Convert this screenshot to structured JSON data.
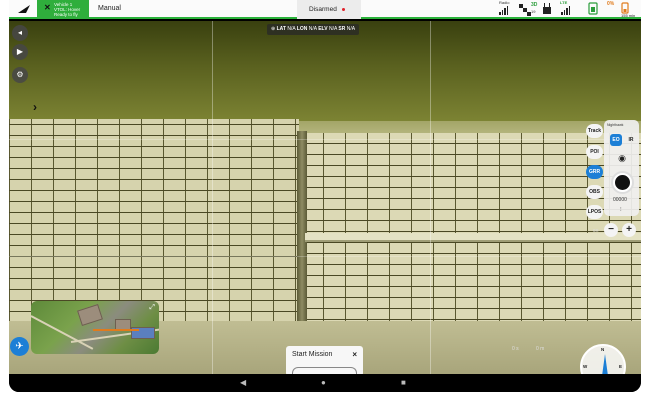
{
  "topbar": {
    "vehicle_line1": "Vehicle 1",
    "vehicle_line2": "VTOL: Hover",
    "vehicle_line3": "Ready to fly",
    "flight_mode": "Manual",
    "arm_status": "Disarmed",
    "status": {
      "radio_label": "Radio",
      "gps_label": "3D",
      "gps_count": "19",
      "lte_label": "LTE",
      "battery_pct": "0%",
      "clock": "155 min"
    },
    "colors": {
      "ready": "#2fae3c",
      "accent": "#1c7fd6",
      "disarmed_dot": "#e0202a"
    }
  },
  "left_tools": [
    "back-icon",
    "play-icon",
    "settings-icon"
  ],
  "gps_readout": {
    "lat_label": "LAT",
    "lat": "N/A",
    "lon_label": "LON",
    "lon": "N/A",
    "elv_label": "ELV",
    "elv": "N/A",
    "sr_label": "SR",
    "sr": "N/A"
  },
  "right_panel": {
    "track": "Track",
    "poi": "POI",
    "grr": "GRR",
    "obs": "OBS",
    "lpos": "LPOS",
    "camera_header": "Nighthawk",
    "eo": "EO",
    "ir": "IR",
    "counter": "00000",
    "zoom_label": "0X",
    "zoom_out": "−",
    "zoom_in": "+"
  },
  "telemetry": {
    "alt": "0 s",
    "dist": "0 m"
  },
  "mission": {
    "title": "Start Mission",
    "close": "×"
  },
  "compass": {
    "n": "N",
    "e": "E",
    "w": "W"
  },
  "navbar": {
    "back": "◀",
    "home": "●",
    "recent": "■"
  }
}
